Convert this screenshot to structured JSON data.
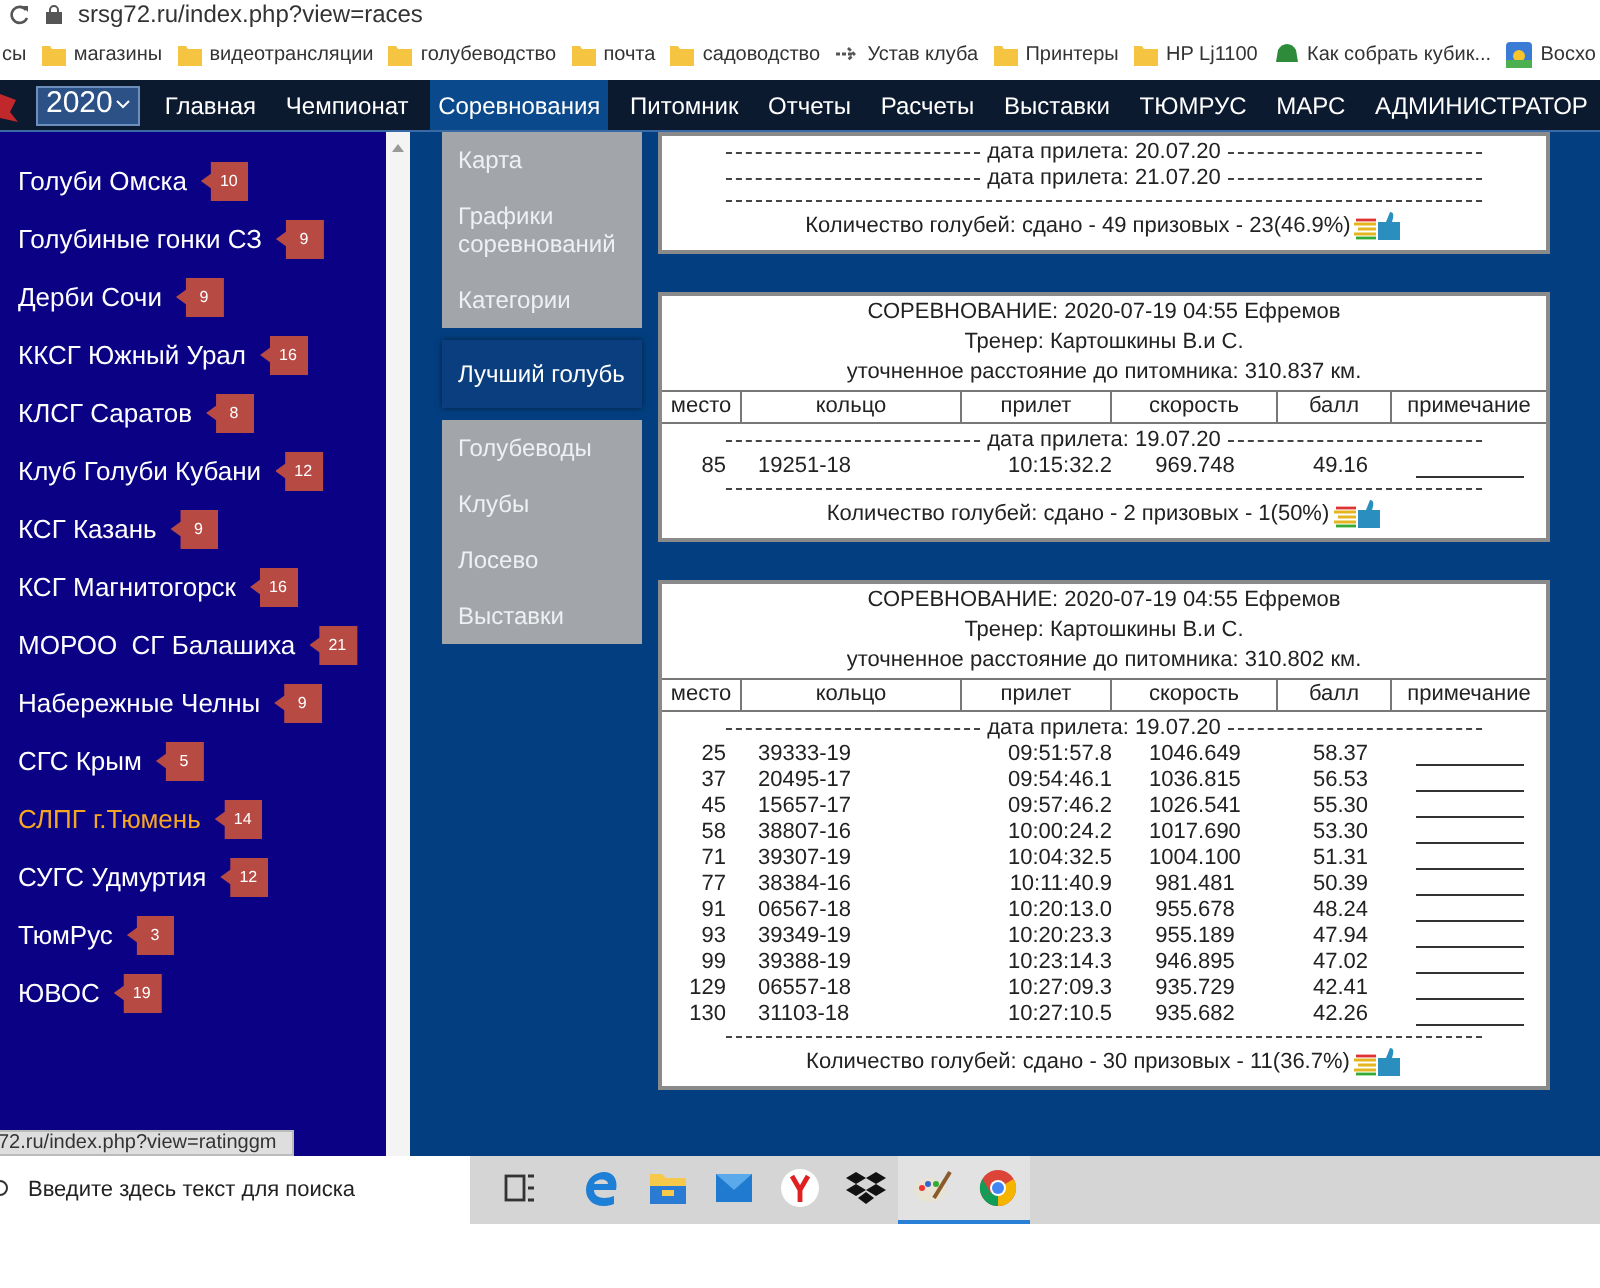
{
  "browser": {
    "url": "srsg72.ru/index.php?view=races",
    "bookmarks": [
      {
        "label": "сы",
        "kind": "none"
      },
      {
        "label": "магазины",
        "kind": "folder"
      },
      {
        "label": "видеотрансляции",
        "kind": "folder"
      },
      {
        "label": "голубеводство",
        "kind": "folder"
      },
      {
        "label": "почта",
        "kind": "folder"
      },
      {
        "label": "садоводство",
        "kind": "folder"
      },
      {
        "label": "Устав клуба",
        "kind": "link"
      },
      {
        "label": "Принтеры",
        "kind": "folder"
      },
      {
        "label": "HP Lj1100",
        "kind": "folder"
      },
      {
        "label": "Как собрать кубик...",
        "kind": "app"
      },
      {
        "label": "Восхо",
        "kind": "image"
      }
    ]
  },
  "nav": {
    "year": "2020",
    "items": [
      {
        "label": "Главная",
        "selected": false
      },
      {
        "label": "Чемпионат",
        "selected": false
      },
      {
        "label": "Соревнования",
        "selected": true
      },
      {
        "label": "Питомник",
        "selected": false
      },
      {
        "label": "Отчеты",
        "selected": false
      },
      {
        "label": "Расчеты",
        "selected": false
      },
      {
        "label": "Выставки",
        "selected": false
      },
      {
        "label": "ТЮМРУС",
        "selected": false
      },
      {
        "label": "МАРС",
        "selected": false
      },
      {
        "label": "АДМИНИСТРАТОР",
        "selected": false
      }
    ]
  },
  "sidebar": {
    "items": [
      {
        "label": "Голуби Омска",
        "count": "10",
        "selected": false
      },
      {
        "label": "Голубиные гонки СЗ",
        "count": "9",
        "selected": false
      },
      {
        "label": "Дерби Сочи",
        "count": "9",
        "selected": false
      },
      {
        "label": "ККСГ Южный Урал",
        "count": "16",
        "selected": false
      },
      {
        "label": "КЛСГ Саратов",
        "count": "8",
        "selected": false
      },
      {
        "label": "Клуб Голуби Кубани",
        "count": "12",
        "selected": false
      },
      {
        "label": "КСГ Казань",
        "count": "9",
        "selected": false
      },
      {
        "label": "КСГ Магнитогорск",
        "count": "16",
        "selected": false
      },
      {
        "label": "МОРОО  СГ Балашиха",
        "count": "21",
        "selected": false
      },
      {
        "label": "Набережные Челны",
        "count": "9",
        "selected": false
      },
      {
        "label": "СГС Крым",
        "count": "5",
        "selected": false
      },
      {
        "label": "СЛПГ г.Тюмень",
        "count": "14",
        "selected": true
      },
      {
        "label": "СУГС Удмуртия",
        "count": "12",
        "selected": false
      },
      {
        "label": "ТюмРус",
        "count": "3",
        "selected": false
      },
      {
        "label": "ЮВОС",
        "count": "19",
        "selected": false
      }
    ]
  },
  "dropdown": {
    "items": [
      {
        "label": "Карта",
        "selected": false
      },
      {
        "label": "Графики соревнований",
        "selected": false
      },
      {
        "label": "Категории",
        "selected": false
      },
      {
        "label": "Лучший голубь",
        "selected": true
      },
      {
        "label": "Голубеводы",
        "selected": false
      },
      {
        "label": "Клубы",
        "selected": false
      },
      {
        "label": "Лосево",
        "selected": false
      },
      {
        "label": "Выставки",
        "selected": false
      }
    ]
  },
  "results": [
    {
      "groups": [
        {
          "date": "дата прилета: 20.07.20"
        },
        {
          "date": "дата прилета: 21.07.20"
        }
      ],
      "summary": "Количество голубей: сдано - 49 призовых - 23(46.9%)"
    },
    {
      "title": "СОРЕВНОВАНИЕ: 2020-07-19 04:55 Ефремов",
      "trainer": "Тренер: Картошкины В.и С.",
      "distance": "уточненное расстояние до питомника: 310.837 км.",
      "columns": [
        "место",
        "кольцо",
        "прилет",
        "скорость",
        "балл",
        "примечание"
      ],
      "groups": [
        {
          "date": "дата прилета: 19.07.20",
          "rows": [
            [
              "85",
              "19251-18",
              "10:15:32.2",
              "969.748",
              "49.16"
            ]
          ]
        }
      ],
      "summary": "Количество голубей: сдано - 2 призовых - 1(50%)"
    },
    {
      "title": "СОРЕВНОВАНИЕ: 2020-07-19 04:55 Ефремов",
      "trainer": "Тренер: Картошкины В.и С.",
      "distance": "уточненное расстояние до питомника: 310.802 км.",
      "columns": [
        "место",
        "кольцо",
        "прилет",
        "скорость",
        "балл",
        "примечание"
      ],
      "groups": [
        {
          "date": "дата прилета: 19.07.20",
          "rows": [
            [
              "25",
              "39333-19",
              "09:51:57.8",
              "1046.649",
              "58.37"
            ],
            [
              "37",
              "20495-17",
              "09:54:46.1",
              "1036.815",
              "56.53"
            ],
            [
              "45",
              "15657-17",
              "09:57:46.2",
              "1026.541",
              "55.30"
            ],
            [
              "58",
              "38807-16",
              "10:00:24.2",
              "1017.690",
              "53.30"
            ],
            [
              "71",
              "39307-19",
              "10:04:32.5",
              "1004.100",
              "51.31"
            ],
            [
              "77",
              "38384-16",
              "10:11:40.9",
              "981.481",
              "50.39"
            ],
            [
              "91",
              "06567-18",
              "10:20:13.0",
              "955.678",
              "48.24"
            ],
            [
              "93",
              "39349-19",
              "10:20:23.3",
              "955.189",
              "47.94"
            ],
            [
              "99",
              "39388-19",
              "10:23:14.3",
              "946.895",
              "47.02"
            ],
            [
              "129",
              "06557-18",
              "10:27:09.3",
              "935.729",
              "42.41"
            ],
            [
              "130",
              "31103-18",
              "10:27:10.5",
              "935.682",
              "42.26"
            ]
          ]
        }
      ],
      "summary": "Количество голубей: сдано - 30 призовых - 11(36.7%)"
    }
  ],
  "status_url": "72.ru/index.php?view=ratinggm",
  "taskbar": {
    "search_placeholder": "Введите здесь текст для поиска",
    "apps": [
      {
        "kind": "taskview",
        "running": false
      },
      {
        "kind": "edge",
        "running": false
      },
      {
        "kind": "files",
        "running": false
      },
      {
        "kind": "mail",
        "running": false
      },
      {
        "kind": "yandex",
        "running": false
      },
      {
        "kind": "dropbox",
        "running": false
      },
      {
        "kind": "paint",
        "running": true
      },
      {
        "kind": "chrome",
        "running": true
      }
    ]
  }
}
